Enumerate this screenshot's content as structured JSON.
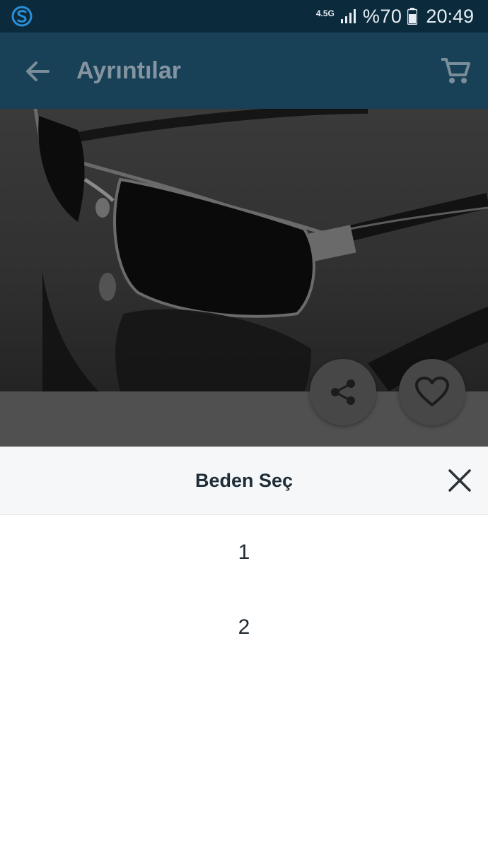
{
  "status_bar": {
    "network_type": "4.5G",
    "battery": "%70",
    "time": "20:49"
  },
  "app_bar": {
    "title": "Ayrıntılar",
    "back_icon": "arrow-left-icon",
    "cart_icon": "cart-icon"
  },
  "product": {
    "share_icon": "share-icon",
    "favorite_icon": "heart-outline-icon"
  },
  "size_sheet": {
    "title": "Beden Seç",
    "close_icon": "close-icon",
    "options": [
      "1",
      "2"
    ]
  },
  "colors": {
    "status_bar": "#0b2b3d",
    "app_bar": "#184057",
    "accent": "#2a8ed8"
  }
}
